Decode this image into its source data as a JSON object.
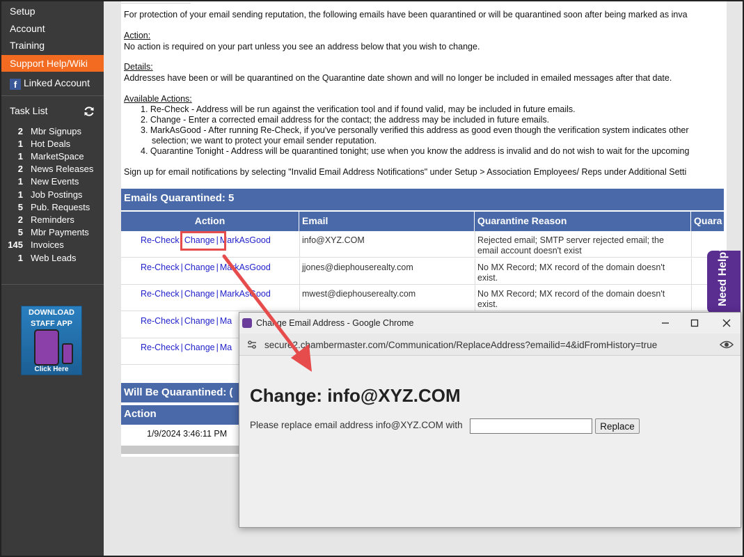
{
  "sidebar": {
    "nav": [
      "Setup",
      "Account",
      "Training",
      "Support Help/Wiki",
      "Linked Account"
    ],
    "task_list_title": "Task List",
    "tasks": [
      {
        "count": "2",
        "label": "Mbr Signups"
      },
      {
        "count": "1",
        "label": "Hot Deals"
      },
      {
        "count": "1",
        "label": "MarketSpace"
      },
      {
        "count": "2",
        "label": "News Releases"
      },
      {
        "count": "1",
        "label": "New Events"
      },
      {
        "count": "1",
        "label": "Job Postings"
      },
      {
        "count": "5",
        "label": "Pub. Requests"
      },
      {
        "count": "2",
        "label": "Reminders"
      },
      {
        "count": "5",
        "label": "Mbr Payments"
      },
      {
        "count": "145",
        "label": "Invoices"
      },
      {
        "count": "1",
        "label": "Web Leads"
      }
    ],
    "app_badge": {
      "line1": "DOWNLOAD",
      "line2": "STAFF APP",
      "click": "Click Here"
    }
  },
  "content": {
    "intro": "For protection of your email sending reputation, the following emails have been quarantined or will be quarantined soon after being marked as inva",
    "action_heading": "Action:",
    "action_text": "No action is required on your part unless you see an address below that you wish to change.",
    "details_heading": "Details:",
    "details_text": "Addresses have been or will be quarantined on the Quarantine date shown and will no longer be included in emailed messages after that date.",
    "available_heading": "Available Actions:",
    "actions": [
      "1. Re-Check - Address will be run against the verification tool and if found valid, may be included in future emails.",
      "2. Change - Enter a corrected email address for the contact; the address may be included in future emails.",
      "3. MarkAsGood - After running Re-Check, if you've personally verified this address as good even though the verification system indicates other",
      "selection; we want to protect your email sender reputation.",
      "4. Quarantine Tonight - Address will be quarantined tonight; use when you know the address is invalid and do not wish to wait for the upcoming"
    ],
    "signup_note": "Sign up for email notifications by selecting \"Invalid Email Address Notifications\" under Setup > Association Employees/ Reps under Additional Setti",
    "quarantined_title": "Emails Quarantined: 5",
    "columns": [
      "Action",
      "Email",
      "Quarantine Reason",
      "Quara"
    ],
    "row_actions": {
      "recheck": "Re-Check",
      "change": "Change",
      "markgood": "MarkAsGood",
      "ma": "Ma",
      "sep": "|"
    },
    "rows": [
      {
        "email": "info@XYZ.COM",
        "reason1": "Rejected email; SMTP server rejected email; the",
        "reason2": "email account doesn't exist"
      },
      {
        "email": "jjones@diephouserealty.com",
        "reason1": "No MX Record; MX record of the domain doesn't",
        "reason2": "exist."
      },
      {
        "email": "mwest@diephouserealty.com",
        "reason1": "No MX Record; MX record of the domain doesn't",
        "reason2": "exist."
      }
    ],
    "will_be_title": "Will Be Quarantined: (",
    "will_be_action_col": "Action",
    "will_be_date": "1/9/2024 3:46:11 PM",
    "help_tab": "Need Help?"
  },
  "popup": {
    "window_title": "Change Email Address - Google Chrome",
    "url": "secure2.chambermaster.com/Communication/ReplaceAddress?emailid=4&idFromHistory=true",
    "heading": "Change: info@XYZ.COM",
    "label": "Please replace email address info@XYZ.COM with",
    "input_value": "",
    "button": "Replace"
  },
  "colors": {
    "sidebar_bg": "#3a3a3a",
    "active_orange": "#f26b21",
    "table_header_blue": "#4a69a8",
    "annotation_red": "#e74c4c"
  }
}
